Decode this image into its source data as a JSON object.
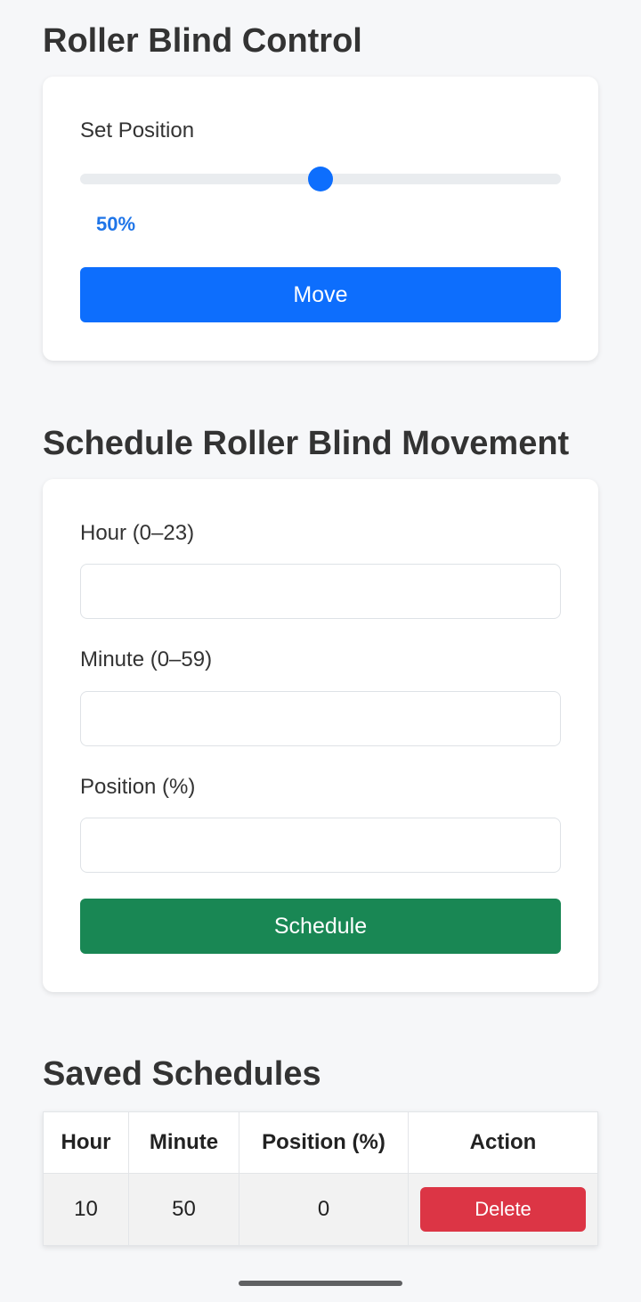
{
  "control": {
    "title": "Roller Blind Control",
    "set_position_label": "Set Position",
    "slider_value": 50,
    "slider_value_text": "50%",
    "move_button": "Move"
  },
  "schedule": {
    "title": "Schedule Roller Blind Movement",
    "hour_label": "Hour (0–23)",
    "hour_value": "",
    "minute_label": "Minute (0–59)",
    "minute_value": "",
    "position_label": "Position (%)",
    "position_value": "",
    "schedule_button": "Schedule"
  },
  "saved": {
    "title": "Saved Schedules",
    "columns": [
      "Hour",
      "Minute",
      "Position (%)",
      "Action"
    ],
    "rows": [
      {
        "hour": "10",
        "minute": "50",
        "position": "0",
        "action": "Delete"
      }
    ]
  },
  "colors": {
    "primary": "#0d6efd",
    "success": "#198754",
    "danger": "#dc3545",
    "background": "#f6f7f9"
  }
}
